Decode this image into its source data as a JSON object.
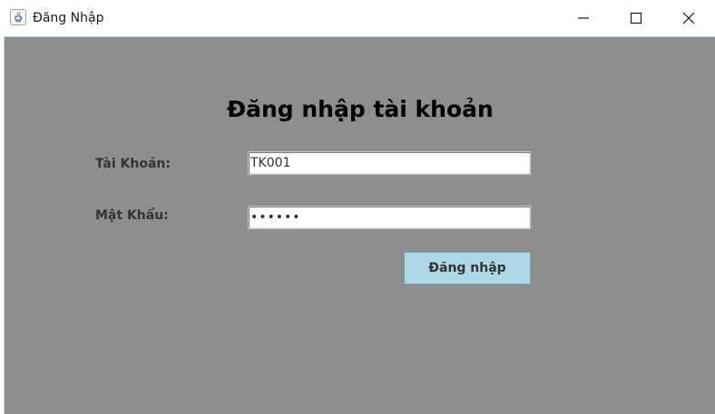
{
  "window": {
    "title": "Đăng Nhập",
    "controls": {
      "minimize": "minimize-icon",
      "maximize": "maximize-icon",
      "close": "close-icon"
    }
  },
  "form": {
    "heading": "Đăng nhập tài khoản",
    "username_label": "Tài Khoản:",
    "username_value": "TK001",
    "password_label": "Mật Khẩu:",
    "password_value": "••••••",
    "login_button": "Đăng nhập"
  },
  "colors": {
    "panel_background": "#8e8e8e",
    "button_background": "#add8e6",
    "heading_text": "#000000",
    "label_text": "#333333"
  }
}
